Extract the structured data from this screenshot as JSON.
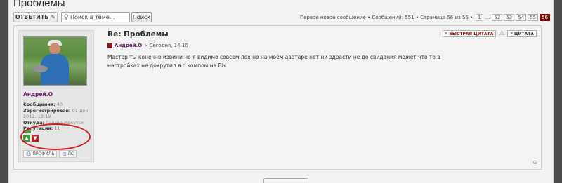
{
  "page": {
    "title": "Проблемы"
  },
  "toolbar": {
    "reply_label": "ОТВЕТИТЬ",
    "reply_icon": "tool-icon",
    "search_placeholder": "Поиск в теме...",
    "search_button": "Поиск"
  },
  "pagination": {
    "info": "Первое новое сообщение • Сообщений: 551 • Страница 56 из 56 •",
    "pages": [
      "1",
      "...",
      "52",
      "53",
      "54",
      "55",
      "56"
    ],
    "current": "56"
  },
  "post": {
    "author": "Андрей.О",
    "stats": {
      "messages_label": "Сообщения:",
      "messages_value": "40",
      "registered_label": "Зарегистрирован:",
      "registered_value": "01 дек 2012, 13:19",
      "from_label": "Откуда:",
      "from_value": "Ганзур-Иркутск",
      "reputation_label": "Репутация:",
      "reputation_value": "11"
    },
    "profile_buttons": [
      "ПРОФИЛЬ",
      "ЛС"
    ],
    "title": "Re: Проблемы",
    "meta_author": "Андрей.О",
    "meta_sep": "»",
    "meta_time": "Сегодня, 14:10",
    "text": "Мастер ты конечно извини но я видимо совсем лох но на моём аватаре нет ни здрасти не до свидания может что то в настройках не докрутил я с компом на ВЫ",
    "quick_quote": "БЫСТРАЯ ЦИТАТА",
    "quote": "ЦИТАТА"
  },
  "colors": {
    "accent": "#7a0b0b",
    "author": "#6a1a6a",
    "highlight": "#d11d1d"
  }
}
